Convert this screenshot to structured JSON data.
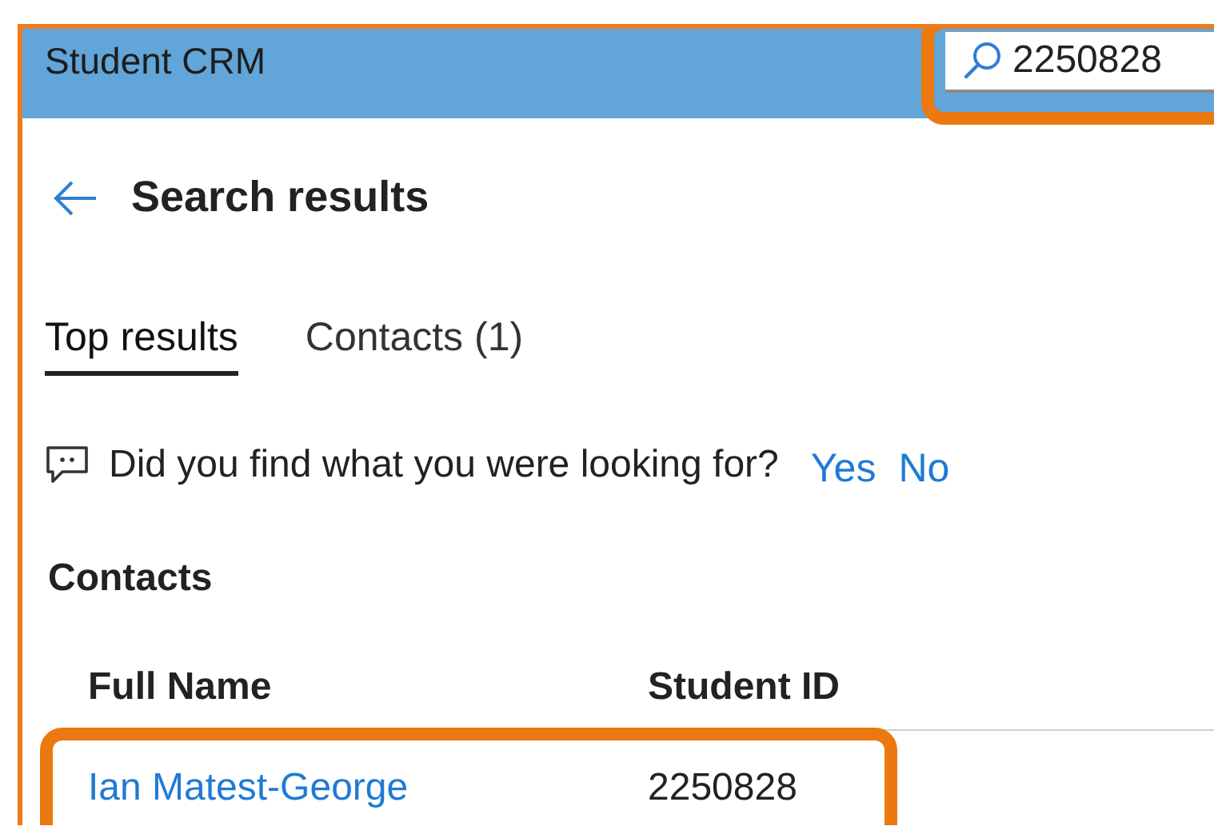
{
  "header": {
    "title": "Student CRM"
  },
  "search": {
    "value": "2250828",
    "highlighted": true
  },
  "page": {
    "title": "Search results"
  },
  "tabs": [
    {
      "label": "Top results",
      "selected": true
    },
    {
      "label": "Contacts (1)",
      "selected": false
    }
  ],
  "feedback": {
    "question": "Did you find what you were looking for?",
    "answers": [
      "Yes",
      "No"
    ]
  },
  "section": {
    "title": "Contacts"
  },
  "table": {
    "columns": [
      "Full Name",
      "Student ID"
    ],
    "rows": [
      {
        "cells": [
          "Ian Matest-George",
          "2250828"
        ],
        "highlighted": true
      }
    ]
  }
}
